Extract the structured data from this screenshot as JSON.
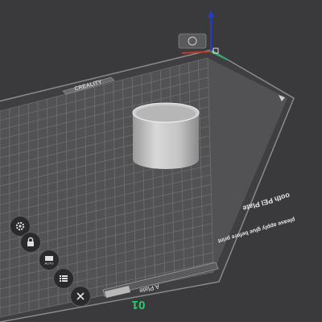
{
  "bed": {
    "brand_label": "CREALITY",
    "plate_title": "Smooth PEI Plate",
    "plate_title_visible": "ooth PEI Plate",
    "plate_note": "please apply glue before print",
    "plate_name": "A Plate",
    "plate_number": "01"
  },
  "side_toolbar": {
    "buttons": [
      {
        "name": "settings-button",
        "icon": "gear-icon"
      },
      {
        "name": "lock-button",
        "icon": "lock-icon"
      },
      {
        "name": "auto-arrange-button",
        "icon": "auto-icon"
      },
      {
        "name": "object-list-button",
        "icon": "list-icon"
      },
      {
        "name": "close-plate-button",
        "icon": "close-icon"
      }
    ]
  },
  "axes": {
    "x_color": "#c0392b",
    "y_color": "#27ae60",
    "z_color": "#1a3fd6"
  },
  "colors": {
    "background": "#3a3a3c",
    "bed_surface": "#525254",
    "grid": "#7a7a7d",
    "plate_number": "#2ecc71",
    "object": "#d0d0d0"
  }
}
